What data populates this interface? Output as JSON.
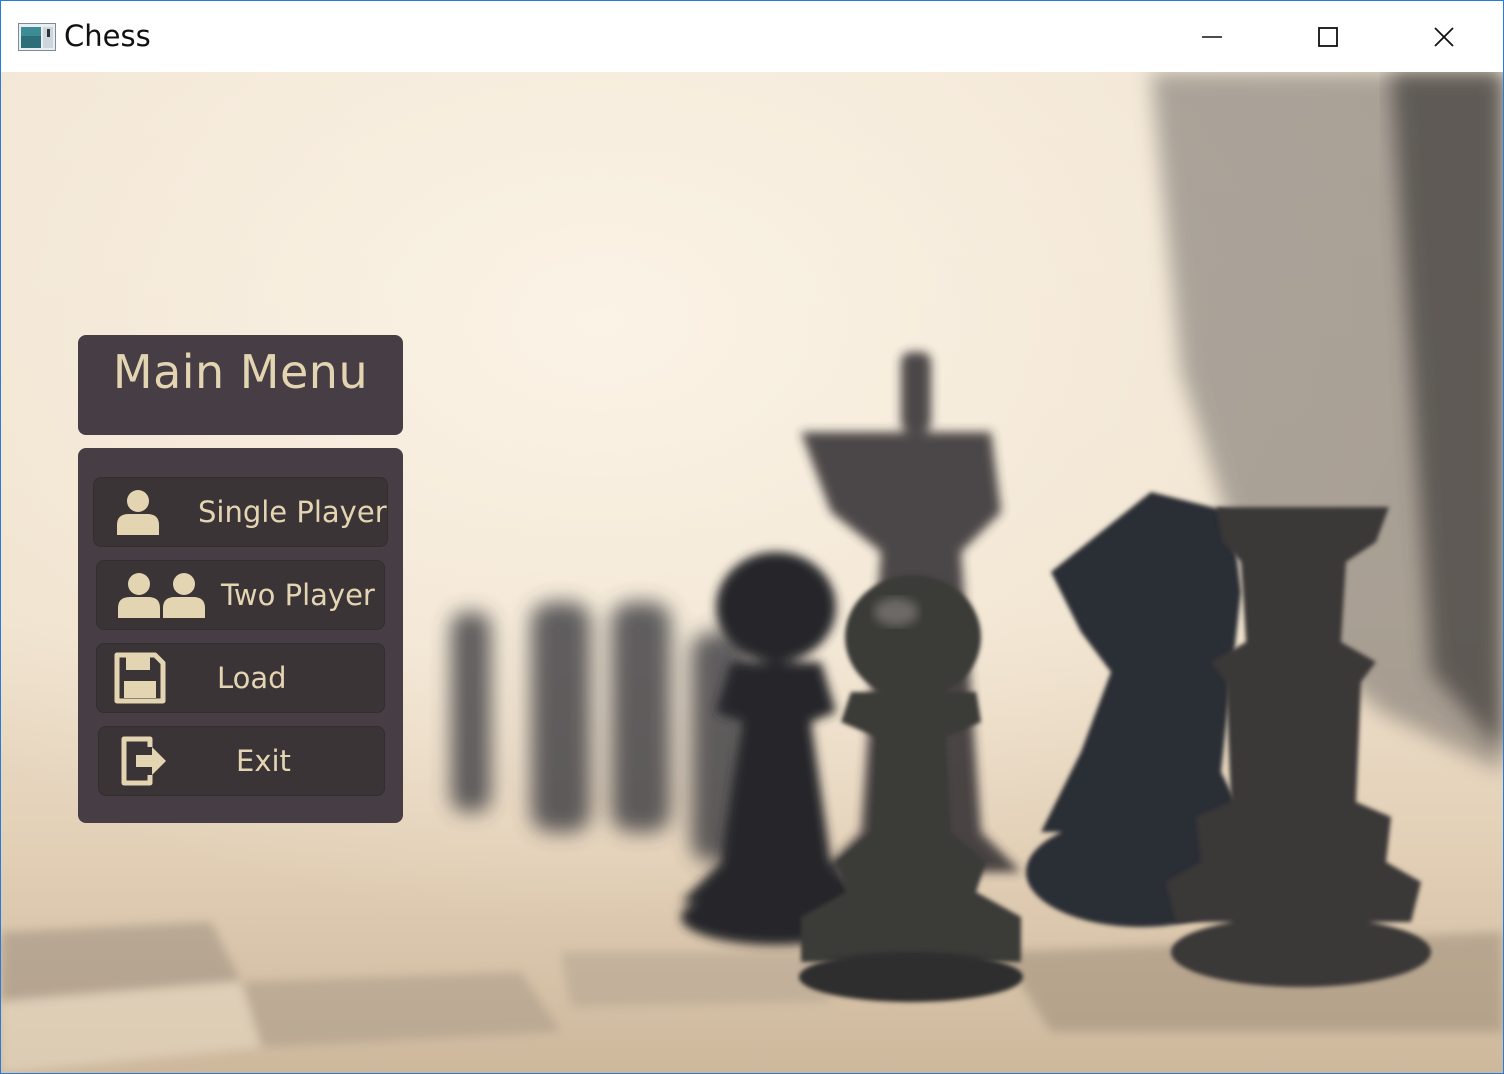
{
  "window": {
    "title": "Chess"
  },
  "menu": {
    "title": "Main Menu",
    "buttons": [
      {
        "label": "Single Player",
        "icon": "single-user-icon"
      },
      {
        "label": "Two Player",
        "icon": "two-users-icon"
      },
      {
        "label": "Load",
        "icon": "floppy-disk-icon"
      },
      {
        "label": "Exit",
        "icon": "exit-door-icon"
      }
    ]
  },
  "colors": {
    "panel": "#463e44",
    "button": "#3b3437",
    "accent_text": "#e4d5b2",
    "window_border": "#2b7bd6"
  }
}
